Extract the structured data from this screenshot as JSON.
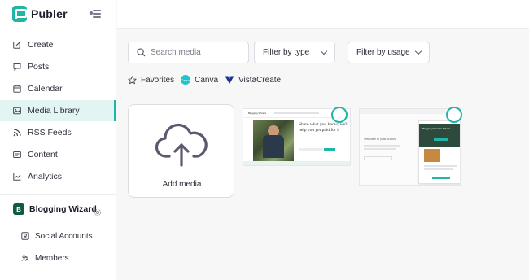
{
  "brand": {
    "name": "Publer",
    "accent": "#1fb6a6"
  },
  "nav": {
    "items": [
      {
        "label": "Create",
        "icon": "edit-icon"
      },
      {
        "label": "Posts",
        "icon": "chat-icon"
      },
      {
        "label": "Calendar",
        "icon": "calendar-icon"
      },
      {
        "label": "Media Library",
        "icon": "image-icon",
        "active": true
      },
      {
        "label": "RSS Feeds",
        "icon": "rss-icon"
      },
      {
        "label": "Content",
        "icon": "content-icon"
      },
      {
        "label": "Analytics",
        "icon": "analytics-icon"
      }
    ]
  },
  "workspace": {
    "badge": "B",
    "name": "Blogging Wizard",
    "items": [
      {
        "label": "Social Accounts",
        "icon": "social-icon"
      },
      {
        "label": "Members",
        "icon": "members-icon"
      }
    ]
  },
  "toolbar": {
    "search_placeholder": "Search media",
    "filter_type": "Filter by type",
    "filter_usage": "Filter by usage"
  },
  "sources": {
    "favorites": "Favorites",
    "canva": "Canva",
    "canva_logo_text": "Canva",
    "vistacreate": "VistaCreate"
  },
  "media": {
    "add_label": "Add media",
    "items": [
      {
        "brand": "Blogging Wizard",
        "headline": "Share what you know; we'll help you get paid for it"
      },
      {
        "brand": "Blogging Wizard's School",
        "headline": "Welcome to your school"
      }
    ]
  }
}
